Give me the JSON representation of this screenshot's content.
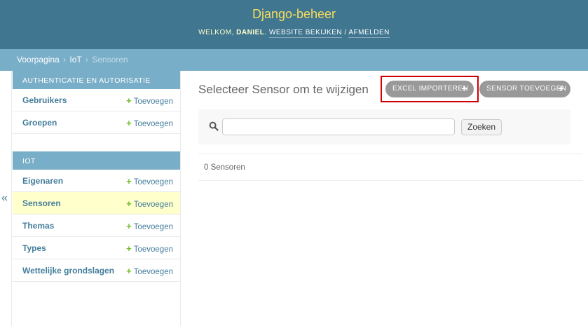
{
  "header": {
    "site_name": "Django-beheer",
    "welcome": "Welkom,",
    "username": "Daniel",
    "period": ".",
    "view_site": "Website bekijken",
    "separator": "/",
    "logout": "Afmelden"
  },
  "breadcrumbs": {
    "home": "Voorpagina",
    "app": "IoT",
    "current": "Sensoren",
    "sep": "›"
  },
  "sidebar": {
    "toggle": "«",
    "modules": [
      {
        "caption": "Authenticatie en autorisatie",
        "models": [
          {
            "name": "Gebruikers",
            "add": "Toevoegen"
          },
          {
            "name": "Groepen",
            "add": "Toevoegen"
          }
        ]
      },
      {
        "caption": "IoT",
        "models": [
          {
            "name": "Eigenaren",
            "add": "Toevoegen"
          },
          {
            "name": "Sensoren",
            "add": "Toevoegen"
          },
          {
            "name": "Themas",
            "add": "Toevoegen"
          },
          {
            "name": "Types",
            "add": "Toevoegen"
          },
          {
            "name": "Wettelijke grondslagen",
            "add": "Toevoegen"
          }
        ]
      }
    ],
    "plus": "+"
  },
  "content": {
    "title": "Selecteer Sensor om te wijzigen",
    "object_tools": {
      "excel_import": "Excel importeren",
      "add_sensor": "Sensor toevoegen",
      "plus": "+"
    },
    "search": {
      "value": "",
      "placeholder": "",
      "button": "Zoeken"
    },
    "result_count": "0 Sensoren"
  },
  "colors": {
    "header": "#417690",
    "site_name": "#f5dd5d",
    "breadcrumbs": "#79aec8",
    "current_row": "#ffffcc",
    "add_plus": "#70bf2b",
    "highlight": "#d00000"
  }
}
